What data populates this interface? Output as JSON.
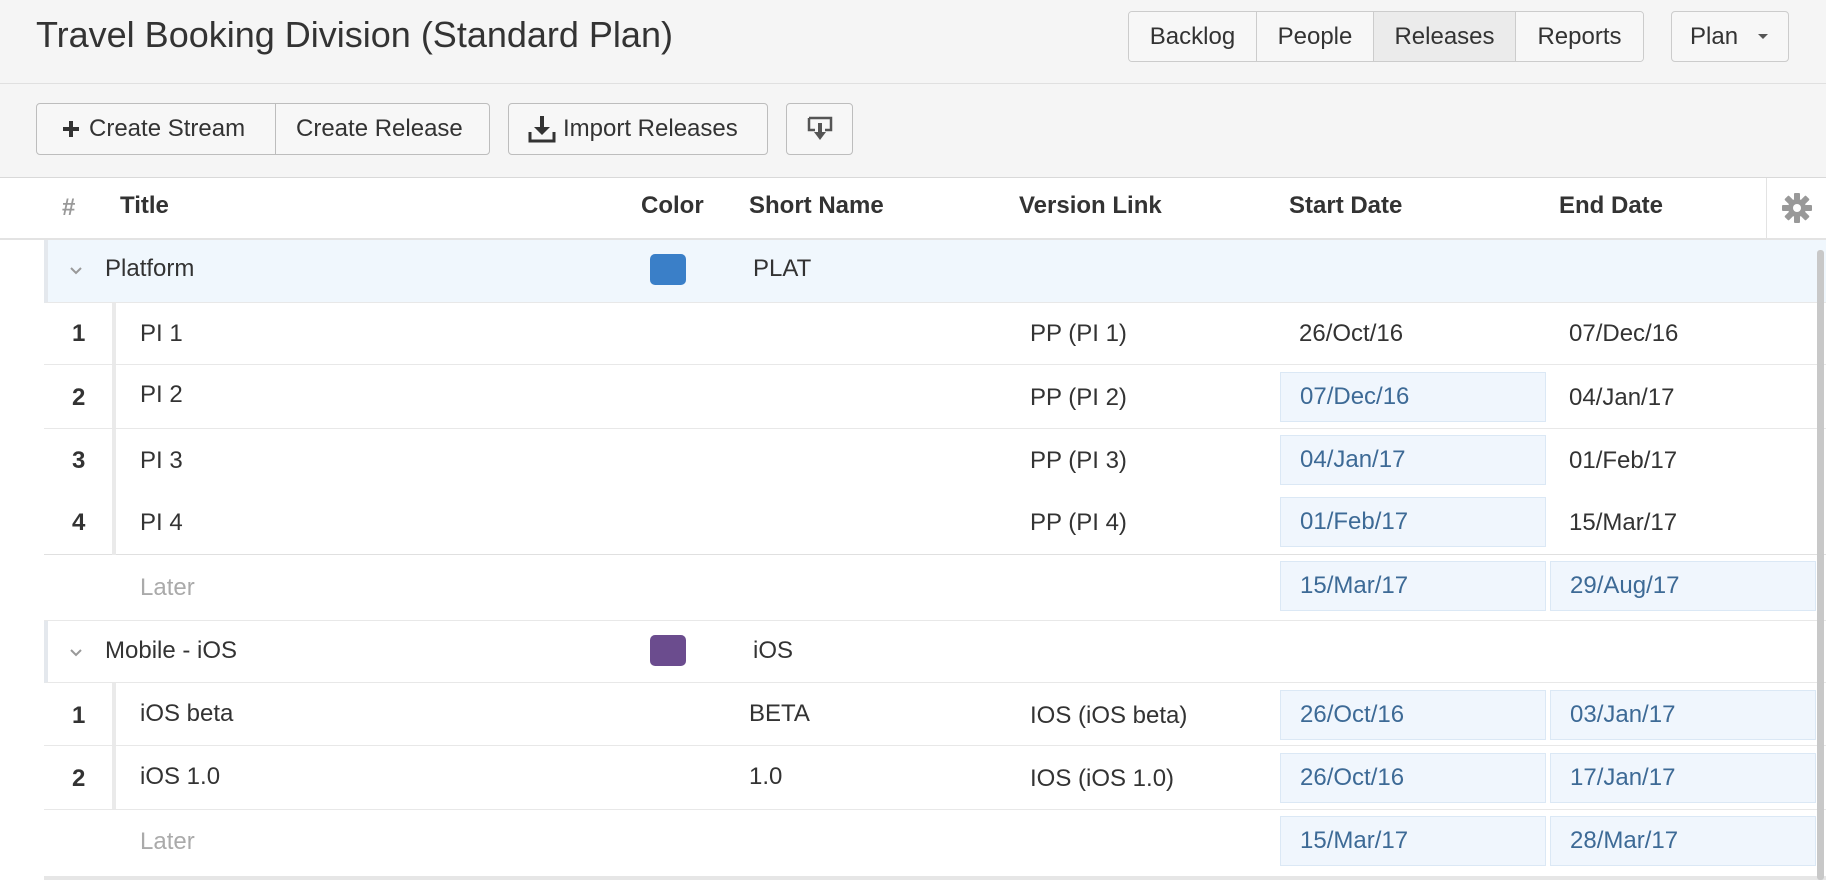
{
  "header": {
    "title": "Travel Booking Division (Standard Plan)",
    "nav": [
      "Backlog",
      "People",
      "Releases",
      "Reports"
    ],
    "active_nav": "Releases",
    "plan_dropdown": "Plan"
  },
  "toolbar": {
    "create_stream": "Create Stream",
    "create_release": "Create Release",
    "import_releases": "Import Releases"
  },
  "table": {
    "columns": {
      "hash": "#",
      "title": "Title",
      "color": "Color",
      "short_name": "Short Name",
      "version_link": "Version Link",
      "start_date": "Start Date",
      "end_date": "End Date"
    },
    "streams": [
      {
        "title": "Platform",
        "color": "#3a7fc8",
        "short_name": "PLAT",
        "releases": [
          {
            "num": "1",
            "title": "PI 1",
            "short_name": "",
            "version_link": "PP (PI 1)",
            "start": "26/Oct/16",
            "end": "07/Dec/16"
          },
          {
            "num": "2",
            "title": "PI 2",
            "short_name": "",
            "version_link": "PP (PI 2)",
            "start": "07/Dec/16",
            "end": "04/Jan/17"
          },
          {
            "num": "3",
            "title": "PI 3",
            "short_name": "",
            "version_link": "PP (PI 3)",
            "start": "04/Jan/17",
            "end": "01/Feb/17"
          },
          {
            "num": "4",
            "title": "PI 4",
            "short_name": "",
            "version_link": "PP (PI 4)",
            "start": "01/Feb/17",
            "end": "15/Mar/17"
          }
        ],
        "later": {
          "title": "Later",
          "start": "15/Mar/17",
          "end": "29/Aug/17"
        }
      },
      {
        "title": "Mobile - iOS",
        "color": "#6b4c8e",
        "short_name": "iOS",
        "releases": [
          {
            "num": "1",
            "title": "iOS beta",
            "short_name": "BETA",
            "version_link": "IOS (iOS beta)",
            "start": "26/Oct/16",
            "end": "03/Jan/17"
          },
          {
            "num": "2",
            "title": "iOS 1.0",
            "short_name": "1.0",
            "version_link": "IOS (iOS 1.0)",
            "start": "26/Oct/16",
            "end": "17/Jan/17"
          }
        ],
        "later": {
          "title": "Later",
          "start": "15/Mar/17",
          "end": "28/Mar/17"
        }
      }
    ]
  },
  "icons": {
    "create_stream": "plus-icon",
    "import": "download-icon",
    "export": "export-icon",
    "settings": "gear-icon",
    "collapse": "chevron-down-icon"
  }
}
